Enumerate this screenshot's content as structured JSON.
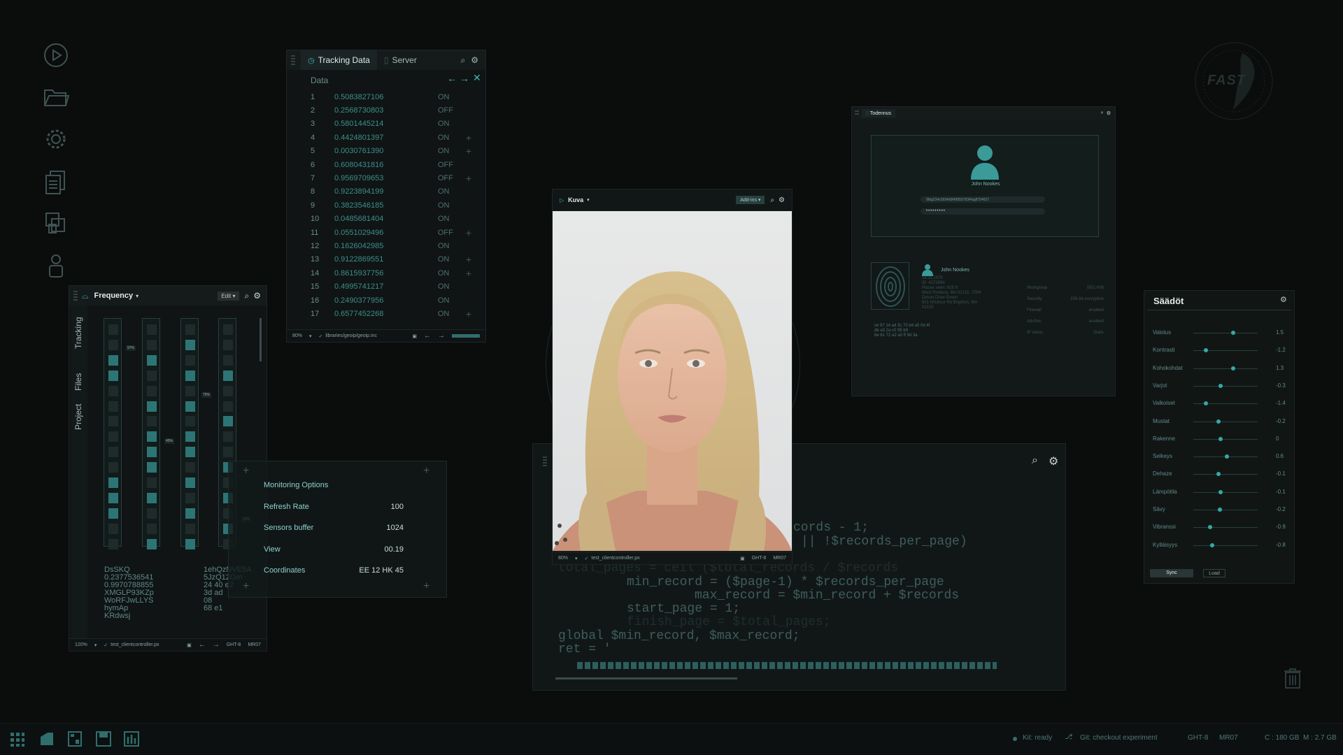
{
  "tracking": {
    "tab_active": "Tracking Data",
    "tab_other": "Server",
    "section_label": "Data",
    "rows": [
      {
        "n": "1",
        "v": "0.5083827106",
        "s": "ON",
        "plus": false
      },
      {
        "n": "2",
        "v": "0.2568730803",
        "s": "OFF",
        "plus": false
      },
      {
        "n": "3",
        "v": "0.5801445214",
        "s": "ON",
        "plus": false
      },
      {
        "n": "4",
        "v": "0.4424801397",
        "s": "ON",
        "plus": true
      },
      {
        "n": "5",
        "v": "0.0030761390",
        "s": "ON",
        "plus": true
      },
      {
        "n": "6",
        "v": "0.6080431816",
        "s": "OFF",
        "plus": false
      },
      {
        "n": "7",
        "v": "0.9569709653",
        "s": "OFF",
        "plus": true
      },
      {
        "n": "8",
        "v": "0.9223894199",
        "s": "ON",
        "plus": false
      },
      {
        "n": "9",
        "v": "0.3823546185",
        "s": "ON",
        "plus": false
      },
      {
        "n": "10",
        "v": "0.0485681404",
        "s": "ON",
        "plus": false
      },
      {
        "n": "11",
        "v": "0.0551029496",
        "s": "OFF",
        "plus": true
      },
      {
        "n": "12",
        "v": "0.1626042985",
        "s": "ON",
        "plus": false
      },
      {
        "n": "13",
        "v": "0.9122869551",
        "s": "ON",
        "plus": true
      },
      {
        "n": "14",
        "v": "0.8615937756",
        "s": "ON",
        "plus": true
      },
      {
        "n": "15",
        "v": "0.4995741217",
        "s": "ON",
        "plus": false
      },
      {
        "n": "16",
        "v": "0.2490377956",
        "s": "ON",
        "plus": false
      },
      {
        "n": "17",
        "v": "0.6577452268",
        "s": "ON",
        "plus": true
      }
    ],
    "status_zoom": "80%",
    "status_path": "libraries/geoip/geoip.inc"
  },
  "frequency": {
    "title": "Frequency",
    "edit_label": "Edit",
    "side_tabs": [
      "Tracking",
      "Files",
      "Project"
    ],
    "column_badges": [
      "97%",
      "45%",
      "75%",
      "33%"
    ],
    "list_left": [
      "DsSKQ",
      "0.2377536541",
      "0.9970788855",
      "XMGLP93KZp",
      "WoRFJwLLYS",
      "hymAp",
      "KRdwsj"
    ],
    "list_right": [
      "1ehQzNVE5A",
      "5JzQ12Gm",
      "24 40 e2",
      "3d ad",
      "08",
      "68 e1"
    ],
    "status_zoom": "120%",
    "status_file": "test_clientcontroller.px",
    "status_enc": "GHT-8",
    "status_mode": "MR07"
  },
  "monitoring": {
    "title": "Monitoring Options",
    "rows": [
      {
        "label": "Refresh Rate",
        "value": "100"
      },
      {
        "label": "Sensors buffer",
        "value": "1024"
      },
      {
        "label": "View",
        "value": "00.19"
      },
      {
        "label": "Coordinates",
        "value": "EE 12 HK 45"
      }
    ]
  },
  "kuva": {
    "title": "Kuva",
    "addins_label": "Add-ins",
    "status_zoom": "80%",
    "status_file": "test_clientcontroller.px",
    "status_enc": "GHT-8",
    "status_mode": "MR07"
  },
  "code": {
    "lines": [
      "cords - 1;",
      "|| !$records_per_page)",
      "total_pages = ceil ($total_records / $records",
      "min_record = ($page-1) * $records_per_page",
      "max_record = $min_record + $records",
      "start_page = 1;",
      "finish_page = $total_pages;",
      "global $min_record, $max_record;",
      "ret = '"
    ]
  },
  "todennus": {
    "title": "Todennus",
    "user_name": "John Nookes",
    "token": "8fdg234s2834d0f49850783f4ag8754627",
    "password_mask": "•••••••••",
    "profile_name": "John Nookes",
    "profile_lines": [
      "18.11.1979",
      "ID: 4273894",
      "Places seen: 925 ft",
      "West Roxbury, MA 02132, 7094",
      "Devon Drive Green",
      "601 Windsor Rd Brighton, MA",
      "02135"
    ],
    "hex_lines": [
      "ce 97 14 ad 3c 70 b4 a5 0d 4f",
      "db a3 2a c0 95 b9",
      "6e 61 72 a2 a0 ff 9d 3a"
    ],
    "props": [
      {
        "k": "Workgroup",
        "v": "SEC-008"
      },
      {
        "k": "Security",
        "v": "256-bit encryption"
      },
      {
        "k": "Firewall",
        "v": "enabled"
      },
      {
        "k": "AdvSec",
        "v": "enabled"
      },
      {
        "k": "IP status",
        "v": "Static"
      }
    ]
  },
  "saadot": {
    "title": "Säädöt",
    "sliders": [
      {
        "label": "Valotus",
        "value": "1.5",
        "pos": 0.62
      },
      {
        "label": "Kontrasti",
        "value": "-1.2",
        "pos": 0.2
      },
      {
        "label": "Kohokohdat",
        "value": "1.3",
        "pos": 0.62
      },
      {
        "label": "Varjot",
        "value": "-0.3",
        "pos": 0.42
      },
      {
        "label": "Valkoiset",
        "value": "-1.4",
        "pos": 0.2
      },
      {
        "label": "Mustat",
        "value": "-0.2",
        "pos": 0.39
      },
      {
        "label": "Rakenne",
        "value": "0",
        "pos": 0.42
      },
      {
        "label": "Selkeys",
        "value": "0.6",
        "pos": 0.52
      },
      {
        "label": "Dehaze",
        "value": "-0.1",
        "pos": 0.39
      },
      {
        "label": "Lämpötila",
        "value": "-0.1",
        "pos": 0.42
      },
      {
        "label": "Sävy",
        "value": "-0.2",
        "pos": 0.41
      },
      {
        "label": "Vibranssi",
        "value": "-0.9",
        "pos": 0.26
      },
      {
        "label": "Kylläisyys",
        "value": "-0.8",
        "pos": 0.29
      }
    ],
    "sync_label": "Sync",
    "load_label": "Load"
  },
  "logo": {
    "text": "FAST"
  },
  "taskbar": {
    "kit_status": "Kit: ready",
    "git_status": "Git: checkout experiment",
    "enc": "GHT-8",
    "mode": "MR07",
    "disk": "C : 180 GB",
    "mem": "M : 2.7 GB"
  },
  "colors": {
    "accent": "#3fb7b5",
    "bg": "#0b0c0c",
    "panel": "#101414"
  }
}
